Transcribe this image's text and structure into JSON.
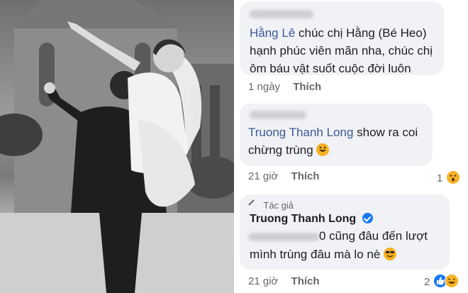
{
  "comments": [
    {
      "author": "Hằng Lê",
      "text_first": "chúc chị Hằng (Bé Heo)",
      "text_lines": [
        "hạnh phúc viên mãn nha, chúc chị",
        "ôm báu vật suốt cuộc đời luôn"
      ],
      "time": "1 ngày",
      "like_label": "Thích"
    },
    {
      "author": "Truong Thanh Long",
      "text_first": "show ra coi",
      "text_line2": "chừng trùng",
      "emoji": "rolling-on-floor-laughing",
      "time": "21 giờ",
      "like_label": "Thích",
      "reaction_count": "1",
      "reaction_icon": "wow-reaction-icon"
    },
    {
      "author_tag": "Tác giả",
      "author": "Truong Thanh Long",
      "text_first": "0 cũng đâu đến lượt",
      "text_line2": "mình trùng đâu mà lo nè",
      "emoji": "smiling-with-sunglasses",
      "time": "21 giờ",
      "like_label": "Thích",
      "reaction_count": "2",
      "reaction_icons": [
        "like-reaction-icon",
        "haha-reaction-icon"
      ]
    }
  ],
  "colors": {
    "name_link": "#3b5998",
    "bubble_bg": "#f0f2f5",
    "meta_text": "#65676b",
    "like_blue": "#1877f2",
    "haha_yellow": "#f7b125"
  }
}
